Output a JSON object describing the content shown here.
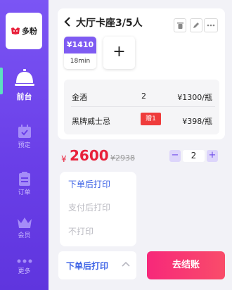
{
  "app": {
    "logo_text": "多粉"
  },
  "sidebar": {
    "items": [
      {
        "label": "前台",
        "icon": "service-bell-icon",
        "active": true
      },
      {
        "label": "预定",
        "icon": "calendar-check-icon",
        "active": false
      },
      {
        "label": "订单",
        "icon": "clipboard-icon",
        "active": false
      },
      {
        "label": "会员",
        "icon": "crown-icon",
        "active": false
      },
      {
        "label": "更多",
        "icon": "more-dots-icon",
        "active": false
      }
    ]
  },
  "table": {
    "title": "大厅卡座3/5人",
    "tile_price": "¥1410",
    "tile_duration": "18min",
    "add_label": "+"
  },
  "orders": [
    {
      "name": "金酒",
      "qty": "2",
      "price": "¥1300/瓶",
      "gift": ""
    },
    {
      "name": "黑牌威士忌",
      "qty": "",
      "price": "¥398/瓶",
      "gift": "赠1"
    }
  ],
  "totals": {
    "currency": "¥",
    "amount": "2600",
    "original": "¥2938",
    "quantity": "2",
    "minus": "−",
    "plus": "+"
  },
  "print_menu": {
    "options": [
      "下单后打印",
      "支付后打印",
      "不打印"
    ],
    "selected": "下单后打印"
  },
  "checkout_label": "去结账",
  "colors": {
    "sidebar": "#6a3fe8",
    "accent": "#7e5bf2",
    "price": "#e8213b",
    "menu_selected": "#3d63e6",
    "checkout": "#f7287a"
  }
}
